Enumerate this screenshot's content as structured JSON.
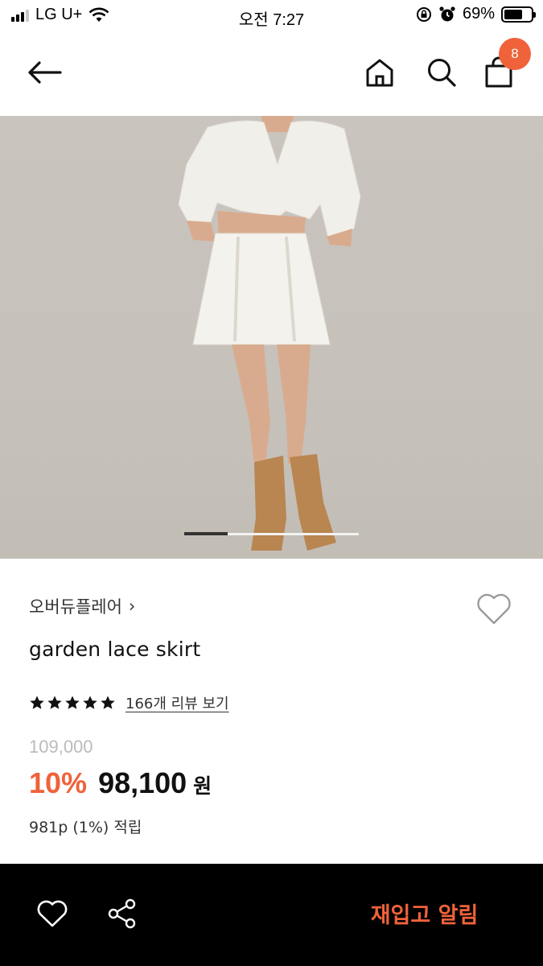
{
  "status_bar": {
    "carrier": "LG U+",
    "time": "오전 7:27",
    "battery_percent": "69%",
    "battery_level": 0.69,
    "icons": [
      "signal-icon",
      "wifi-icon",
      "rotation-lock-icon",
      "alarm-icon",
      "battery-icon"
    ]
  },
  "header": {
    "icons": [
      "back-arrow-icon",
      "home-icon",
      "search-icon",
      "shopping-bag-icon"
    ],
    "cart_count": "8"
  },
  "product_image": {
    "carousel_position": 1,
    "carousel_progress": 0.25
  },
  "product": {
    "brand": "오버듀플레어",
    "brand_chevron": "›",
    "name": "garden lace skirt",
    "rating_stars": 5,
    "review_link": "166개 리뷰 보기",
    "original_price": "109,000",
    "discount": "10%",
    "sale_price": "98,100",
    "currency": "원",
    "points": "981p (1%) 적립"
  },
  "bottom_bar": {
    "restock_label": "재입고 알림",
    "icons": [
      "heart-icon",
      "share-icon"
    ]
  },
  "colors": {
    "accent": "#f0623a",
    "bottom_bar": "#000000",
    "muted_price": "#bbbbbb"
  }
}
